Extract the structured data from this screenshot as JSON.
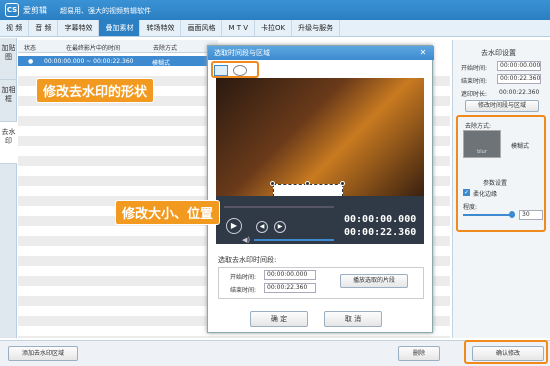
{
  "titlebar": {
    "logo": "CS",
    "app_name": "爱剪辑",
    "slogan": "超易用、强大的视频剪辑软件"
  },
  "menu": [
    "视 频",
    "音 频",
    "字幕特效",
    "叠加素材",
    "转场特效",
    "画面风格",
    "M T V",
    "卡拉OK",
    "升级与服务"
  ],
  "menu_active": 3,
  "sidetabs": [
    {
      "label": "加贴图"
    },
    {
      "label": "加相框"
    },
    {
      "label": "去水印"
    }
  ],
  "list": {
    "headers": [
      "状态",
      "在最终影片中的时间",
      "去除方式"
    ],
    "row": {
      "time": "00:00:00.000 ~ 00:00:22.360",
      "mode": "模糊式"
    }
  },
  "right_panel": {
    "section_title": "去水印设置",
    "start_label": "开始时间:",
    "start_value": "00:00:00.000",
    "end_label": "结束时间:",
    "end_value": "00:00:22.360",
    "duration_label": "遮印时长:",
    "duration_value": "00:00:22.360",
    "modify_button": "修改时间段与区域",
    "method_label": "去除方式:",
    "method_value": "模糊式",
    "param_title": "参数设置",
    "soften_label": "柔化边缘",
    "degree_label": "程度:",
    "degree_value": "30",
    "confirm_button": "确认修改"
  },
  "dialog": {
    "title": "选取时间段与区域",
    "time_current": "00:00:00.000",
    "time_total": "00:00:22.360",
    "range_title": "选取去水印时间段:",
    "start_label": "开始时间:",
    "start_value": "00:00:00.000",
    "end_label": "结束时间:",
    "end_value": "00:00:22.360",
    "play_button": "播放选取的片段",
    "ok": "确 定",
    "cancel": "取 消"
  },
  "callouts": {
    "shape": "修改去水印的形状",
    "size": "修改大小、位置"
  },
  "bottom": {
    "add": "添加去水印区域",
    "delete": "删除"
  }
}
